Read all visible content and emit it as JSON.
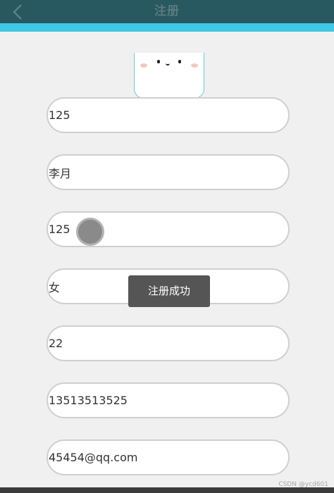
{
  "header": {
    "title": "注册"
  },
  "form": {
    "fields": [
      {
        "name": "account-field",
        "value": "125"
      },
      {
        "name": "name-field",
        "value": "李月"
      },
      {
        "name": "password-field",
        "value": "125"
      },
      {
        "name": "gender-field",
        "value": "女"
      },
      {
        "name": "age-field",
        "value": "22"
      },
      {
        "name": "phone-field",
        "value": "13513513525"
      },
      {
        "name": "email-field",
        "value": "45454@qq.com"
      }
    ]
  },
  "toast": {
    "message": "注册成功"
  },
  "watermark": {
    "text": "CSDN @ycd601"
  },
  "colors": {
    "header_bg": "#285860",
    "accent": "#40c8e4",
    "page_bg": "#f0f0f0",
    "toast_bg": "#555555"
  },
  "icons": {
    "back": "chevron-left-icon"
  }
}
